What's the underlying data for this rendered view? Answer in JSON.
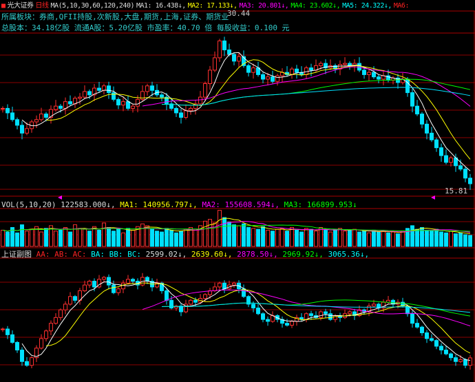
{
  "header": {
    "icon": "stock-icon",
    "name": "光大证券",
    "period": "日线",
    "ma_params": "MA(5,10,30,60,120,240)",
    "ma1": "MA1: 16.438↓,",
    "ma2": "MA2: 17.133↓,",
    "ma3": "MA3: 20.801↓,",
    "ma4": "MA4: 23.602↓,",
    "ma5": "MA5: 24.322↓,",
    "ma6": "MA6:"
  },
  "info1": "所属板块：券商,QFII持股,次新股,大盘,期货,上海,证券、期货业",
  "info2": "总股本：34.18亿股   流通A股：5.20亿股   市盈率：40.70 倍   每股收益：0.100 元",
  "price_high_label": "30.44",
  "price_low_label": "15.81",
  "vol_header": {
    "params": "VOL(5,10,20)",
    "value": "122583.000↓,",
    "ma1": "MA1: 140956.797↓,",
    "ma2": "MA2: 155608.594↓,",
    "ma3": "MA3: 166899.953↓"
  },
  "index_header": {
    "name": "上证副图",
    "aa": "AA:",
    "ab": "AB:",
    "ac": "AC:",
    "ba": "BA:",
    "bb": "BB:",
    "bc": "BC:",
    "v1": "2599.02↓,",
    "v2": "2639.60↓,",
    "v3": "2878.50↓,",
    "v4": "2969.92↓,",
    "v5": "3065.36↓,"
  },
  "colors": {
    "up": "#ff3030",
    "down": "#00e0ff",
    "grid": "#8b0000",
    "ma": [
      "#ffffff",
      "#ffff00",
      "#ff00ff",
      "#00ff00",
      "#00e0ff"
    ]
  },
  "chart_data": [
    {
      "type": "candlestick",
      "title": "光大证券 日线",
      "ylim": [
        15.5,
        30.8
      ],
      "close": [
        23.0,
        22.6,
        22.0,
        21.5,
        20.8,
        21.2,
        21.8,
        22.0,
        22.5,
        22.2,
        22.9,
        23.2,
        23.0,
        23.6,
        23.4,
        23.9,
        24.0,
        24.5,
        24.2,
        24.8,
        24.6,
        25.0,
        24.4,
        23.8,
        23.3,
        23.6,
        23.0,
        23.2,
        23.8,
        24.5,
        25.0,
        24.6,
        24.2,
        24.0,
        23.4,
        23.0,
        22.6,
        22.2,
        22.8,
        23.0,
        23.4,
        24.0,
        25.2,
        26.4,
        27.5,
        29.0,
        28.2,
        27.8,
        27.2,
        27.6,
        26.8,
        26.2,
        26.6,
        26.0,
        25.6,
        25.8,
        25.4,
        25.9,
        26.2,
        26.0,
        26.5,
        26.2,
        26.0,
        26.6,
        26.4,
        26.8,
        27.0,
        26.6,
        26.8,
        26.5,
        26.9,
        27.0,
        26.8,
        27.0,
        26.4,
        26.0,
        26.2,
        25.8,
        25.6,
        25.9,
        25.5,
        25.7,
        25.3,
        25.6,
        24.4,
        23.2,
        22.5,
        21.6,
        20.8,
        20.2,
        19.5,
        18.8,
        18.2,
        18.6,
        17.9,
        17.6,
        16.8,
        16.3
      ],
      "ma_periods": [
        5,
        10,
        30,
        60,
        120
      ]
    },
    {
      "type": "bar",
      "title": "VOL(5,10,20)",
      "ylim": [
        0,
        420000
      ],
      "values": [
        180000,
        160000,
        210000,
        150000,
        240000,
        170000,
        190000,
        220000,
        160000,
        200000,
        230000,
        170000,
        180000,
        210000,
        160000,
        240000,
        200000,
        190000,
        170000,
        220000,
        180000,
        260000,
        210000,
        170000,
        190000,
        150000,
        200000,
        180000,
        220000,
        250000,
        230000,
        190000,
        170000,
        160000,
        200000,
        180000,
        150000,
        170000,
        190000,
        210000,
        180000,
        230000,
        280000,
        300000,
        260000,
        400000,
        320000,
        270000,
        240000,
        230000,
        250000,
        210000,
        200000,
        190000,
        220000,
        180000,
        170000,
        190000,
        200000,
        170000,
        210000,
        180000,
        160000,
        200000,
        190000,
        170000,
        210000,
        180000,
        160000,
        190000,
        200000,
        170000,
        180000,
        190000,
        160000,
        170000,
        150000,
        180000,
        160000,
        170000,
        150000,
        160000,
        140000,
        170000,
        200000,
        230000,
        190000,
        210000,
        180000,
        170000,
        190000,
        160000,
        150000,
        170000,
        140000,
        150000,
        130000,
        122583
      ]
    },
    {
      "type": "candlestick",
      "title": "上证副图",
      "ylim": [
        2480,
        3110
      ],
      "close": [
        2750,
        2720,
        2680,
        2640,
        2580,
        2560,
        2600,
        2650,
        2700,
        2740,
        2780,
        2810,
        2850,
        2880,
        2920,
        2900,
        2950,
        2980,
        3000,
        2970,
        3010,
        3020,
        2980,
        2940,
        2960,
        2990,
        3010,
        3000,
        2980,
        3020,
        3000,
        2970,
        2990,
        2950,
        2900,
        2860,
        2870,
        2840,
        2880,
        2900,
        2890,
        2910,
        2930,
        2950,
        2970,
        2990,
        2960,
        2980,
        2990,
        2960,
        2920,
        2880,
        2860,
        2830,
        2800,
        2790,
        2820,
        2800,
        2780,
        2770,
        2790,
        2810,
        2800,
        2830,
        2820,
        2810,
        2840,
        2830,
        2800,
        2820,
        2810,
        2830,
        2840,
        2820,
        2850,
        2840,
        2870,
        2880,
        2860,
        2890,
        2900,
        2880,
        2890,
        2870,
        2830,
        2780,
        2760,
        2730,
        2700,
        2690,
        2660,
        2640,
        2620,
        2600,
        2580,
        2590,
        2560,
        2599
      ]
    }
  ]
}
